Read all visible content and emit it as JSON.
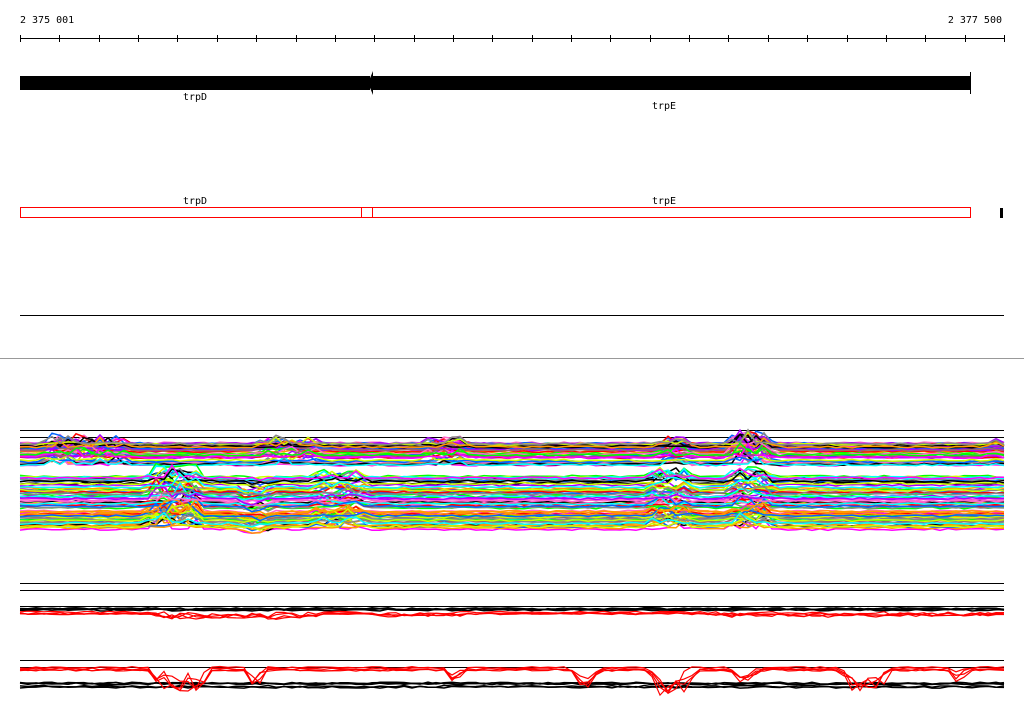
{
  "ruler": {
    "start_label": "2 375 001",
    "end_label": "2 377 500",
    "tick_count": 25
  },
  "genes_track": {
    "genes": [
      {
        "name": "trpD",
        "strand": "-"
      },
      {
        "name": "trpE",
        "strand": "-"
      }
    ]
  },
  "cds_track": {
    "genes": [
      {
        "name": "trpD"
      },
      {
        "name": "trpE"
      }
    ]
  },
  "colors": {
    "gene": "#000000",
    "cds_outline": "#ff0000",
    "divider": "#999999",
    "profile_palette": [
      "#ff00ff",
      "#000000",
      "#0066ff",
      "#ff0000",
      "#00ffff",
      "#00ff00",
      "#ff9900",
      "#aa00ff",
      "#996666",
      "#ccff00",
      "#888888",
      "#ff66cc"
    ]
  }
}
